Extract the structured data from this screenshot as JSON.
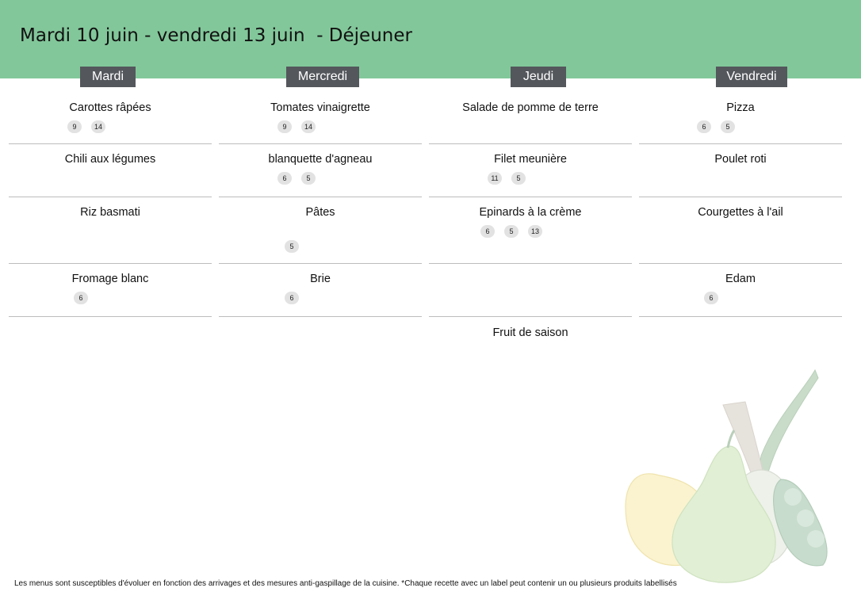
{
  "title": "Mardi 10 juin - vendredi 13 juin  - Déjeuner",
  "days": [
    {
      "name": "Mardi",
      "dishes": [
        {
          "name": "Carottes râpées",
          "labels": [
            "9",
            "14"
          ]
        },
        {
          "name": "Chili aux légumes",
          "labels": []
        },
        {
          "name": "Riz basmati",
          "labels": []
        },
        {
          "name": "Fromage blanc",
          "labels": [
            "6"
          ]
        }
      ]
    },
    {
      "name": "Mercredi",
      "dishes": [
        {
          "name": "Tomates vinaigrette",
          "labels": [
            "9",
            "14"
          ]
        },
        {
          "name": "blanquette d'agneau",
          "labels": [
            "6",
            "5"
          ]
        },
        {
          "name": "Pâtes",
          "labels": [
            "5"
          ]
        },
        {
          "name": "Brie",
          "labels": [
            "6"
          ]
        }
      ]
    },
    {
      "name": "Jeudi",
      "dishes": [
        {
          "name": "Salade de pomme de terre",
          "labels": []
        },
        {
          "name": "Filet meunière",
          "labels": [
            "11",
            "5"
          ]
        },
        {
          "name": "Epinards à la crème",
          "labels": [
            "6",
            "5",
            "13"
          ]
        },
        {
          "name": "",
          "labels": []
        },
        {
          "name": "Fruit de saison",
          "labels": []
        }
      ]
    },
    {
      "name": "Vendredi",
      "dishes": [
        {
          "name": "Pizza",
          "labels": [
            "6",
            "5"
          ]
        },
        {
          "name": "Poulet roti",
          "labels": []
        },
        {
          "name": "Courgettes à l'ail",
          "labels": []
        },
        {
          "name": "Edam",
          "labels": [
            "6"
          ]
        }
      ]
    }
  ],
  "footer": "Les menus sont susceptibles d'évoluer en fonction des arrivages et des mesures anti-gaspillage de la cuisine. *Chaque recette avec un label peut contenir un ou plusieurs produits labellisés",
  "colors": {
    "header_bg": "#82c79a",
    "day_label_bg": "#54575c",
    "badge_bg": "#e2e2e2"
  }
}
